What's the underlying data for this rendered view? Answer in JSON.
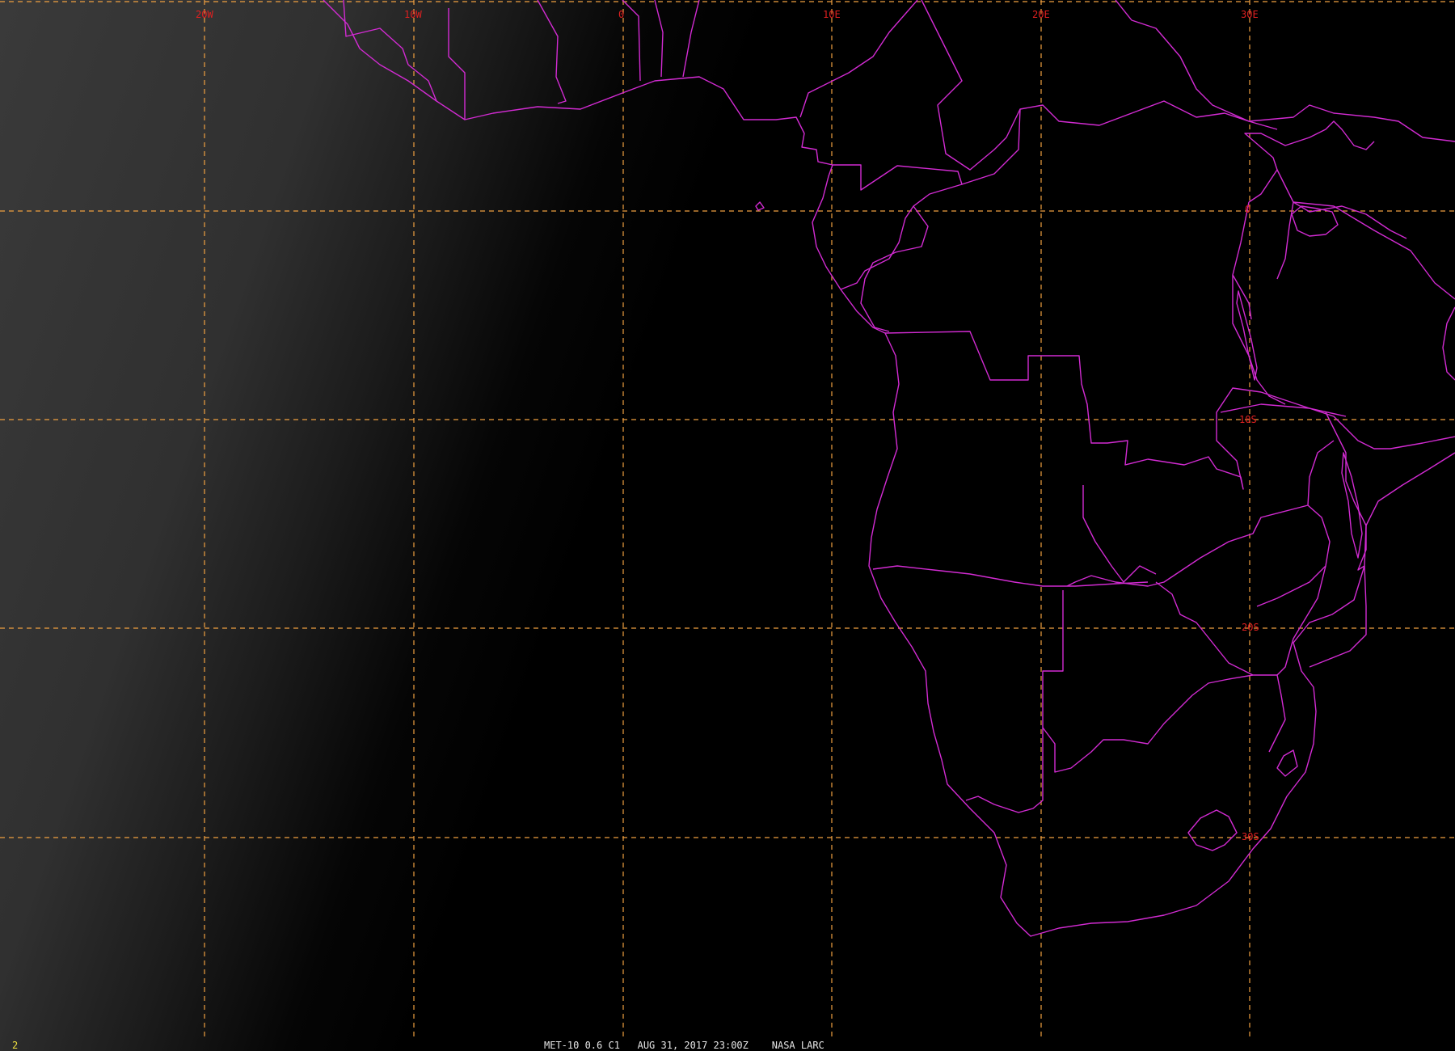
{
  "map": {
    "frame_number": "2",
    "caption": "MET-10 0.6 C1   AUG 31, 2017 23:00Z    NASA LARC",
    "longitude_labels": [
      "20W",
      "10W",
      "0",
      "10E",
      "20E",
      "30E"
    ],
    "latitude_labels": [
      "0",
      "10S",
      "20S",
      "30S"
    ],
    "colors": {
      "background": "#000000",
      "grid": "#f0a040",
      "boundaries": "#d22bd2",
      "grid_labels": "#e02020",
      "caption": "#e6e6e6",
      "frame_number": "#f0e040"
    }
  }
}
